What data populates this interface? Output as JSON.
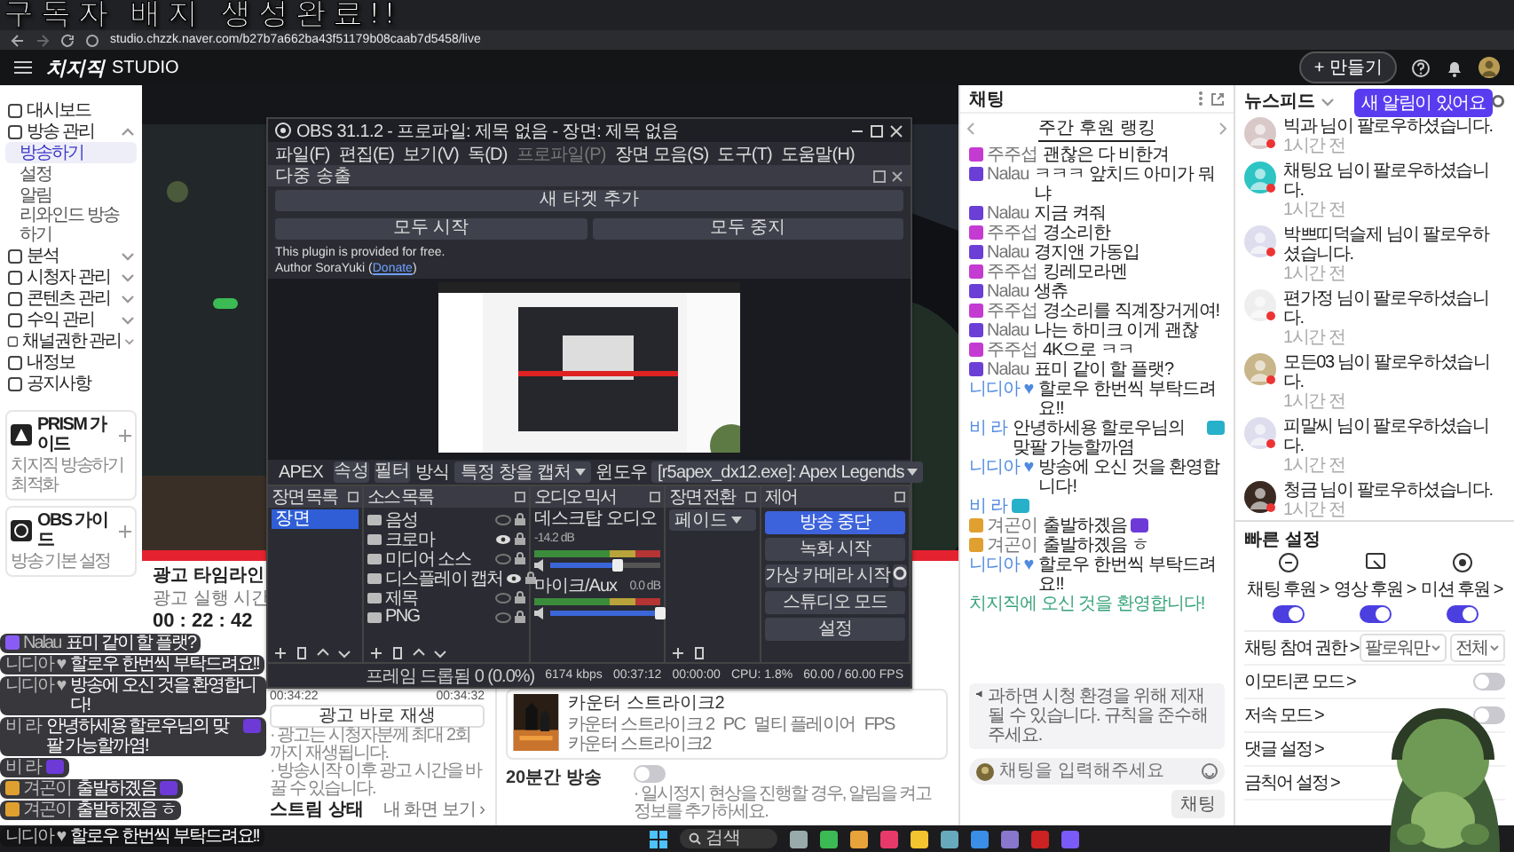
{
  "stream_overlay": {
    "title": "구독자 배지 생성완료!!"
  },
  "browser": {
    "url": "studio.chzzk.naver.com/b27b7a662ba43f51179b08caab7d5458/live"
  },
  "header": {
    "logo": "치지직",
    "product": "STUDIO",
    "create_button": "+ 만들기"
  },
  "sidebar": {
    "items": [
      {
        "label": "대시보드"
      },
      {
        "label": "방송 관리",
        "expanded": true,
        "children": [
          {
            "label": "방송하기",
            "selected": true
          },
          {
            "label": "설정",
            "selected": false
          },
          {
            "label": "알림",
            "selected": false
          },
          {
            "label": "리와인드 방송 하기",
            "selected": false
          }
        ]
      },
      {
        "label": "분석",
        "expanded": false
      },
      {
        "label": "시청자 관리",
        "expanded": false
      },
      {
        "label": "콘텐츠 관리",
        "expanded": false
      },
      {
        "label": "수익 관리",
        "expanded": false
      },
      {
        "label": "채널권한 관리",
        "expanded": false
      },
      {
        "label": "내정보"
      },
      {
        "label": "공지사항"
      }
    ],
    "guides": [
      {
        "title": "PRISM 가이드",
        "subtitle": "치지직 방송하기 최적화"
      },
      {
        "title": "OBS 가이드",
        "subtitle": "방송 기본 설정"
      }
    ]
  },
  "ad_timeline": {
    "title": "광고 타임라인",
    "label": "광고 실행 시간",
    "time": "00 : 22 : 42",
    "marks": [
      "00:34:22",
      "00:34:32"
    ],
    "button": "광고 바로 재생",
    "notes": [
      "· 광고는 시청자분께 최대 2회까지 재생됩니다.",
      "· 방송시작 이후 광고 시간을 바꿀 수 있습니다."
    ]
  },
  "stream_status": {
    "title": "스트림 상태",
    "link": "내 화면 보기 ›"
  },
  "game": {
    "title": "카운터 스트라이크2",
    "tags": [
      "카운터 스트라이크 2",
      "PC",
      "멀티 플레이어",
      "FPS",
      "카운터 스트라이크2"
    ]
  },
  "setting_row": {
    "label": "20분간 방송",
    "on": false,
    "note": "· 일시정지 현상을 진행할 경우, 알림을 켜고 정보를 추가하세요."
  },
  "obs": {
    "title": "OBS 31.1.2 - 프로파일: 제목 없음 - 장면: 제목 없음",
    "menu": [
      {
        "label": "파일(F)",
        "disabled": false
      },
      {
        "label": "편집(E)",
        "disabled": false
      },
      {
        "label": "보기(V)",
        "disabled": false
      },
      {
        "label": "독(D)",
        "disabled": false
      },
      {
        "label": "프로파일(P)",
        "disabled": true
      },
      {
        "label": "장면 모음(S)",
        "disabled": false
      },
      {
        "label": "도구(T)",
        "disabled": false
      },
      {
        "label": "도움말(H)",
        "disabled": false
      }
    ],
    "dock_title": "다중 송출",
    "add_button": "새 타겟 추가",
    "start_all": "모두 시작",
    "stop_all": "모두 중지",
    "plugin_text": "This plugin is provided for free.",
    "author_prefix": "Author SoraYuki (",
    "author_link": "Donate",
    "author_suffix": ")",
    "source_name": "APEX",
    "properties_button": "속성",
    "filters_button": "필터",
    "method_label": "방식",
    "method_value": "특정 창을 캡처",
    "window_label": "윈도우",
    "window_value": "[r5apex_dx12.exe]: Apex Legends",
    "scenes": {
      "title": "장면 목록",
      "items": [
        {
          "label": "장면",
          "selected": true
        }
      ]
    },
    "sources": {
      "title": "소스 목록",
      "items": [
        {
          "label": "음성",
          "visible": false
        },
        {
          "label": "크로마",
          "visible": true
        },
        {
          "label": "미디어 소스",
          "visible": false
        },
        {
          "label": "디스플레이 캡처",
          "visible": true
        },
        {
          "label": "제목",
          "visible": false
        },
        {
          "label": "PNG",
          "visible": false
        }
      ]
    },
    "mixer": {
      "title": "오디오 믹서",
      "channels": [
        {
          "name": "데스크탑 오디오",
          "reading": "-14.2 dB",
          "level": 0.62
        },
        {
          "name": "마이크/Aux",
          "reading": "0.0 dB",
          "level": 1
        }
      ]
    },
    "transitions": {
      "title": "장면 전환",
      "value": "페이드"
    },
    "controls": {
      "title": "제어",
      "buttons": [
        {
          "label": "방송 중단",
          "active": true
        },
        {
          "label": "녹화 시작",
          "active": false
        },
        {
          "label": "가상 카메라 시작",
          "active": false
        },
        {
          "label": "스튜디오 모드",
          "active": false
        },
        {
          "label": "설정",
          "active": false
        }
      ]
    },
    "status": [
      "프레임 드롭됨 0 (0.0%)",
      "6174 kbps",
      "00:37:12",
      "00:00:00",
      "CPU: 1.8%",
      "60.00 / 60.00 FPS"
    ]
  },
  "chat_overlay": [
    {
      "name": "Nalau",
      "color": "#8a5cf6",
      "text": "표미 같이 할 플랫?",
      "emote": false
    },
    {
      "name": "니디아 ♥",
      "text": "할로우 한번씩 부탁드려요!!",
      "emote": false
    },
    {
      "name": "니디아 ♥",
      "text": "방송에 오신 것을 환영합니다!",
      "emote": false
    },
    {
      "name": "비 라",
      "text": "안녕하세용 할로우님의 맞팔 가능할까염!",
      "emote": true
    },
    {
      "name": "비 라",
      "emote": true
    },
    {
      "name": "겨곤이",
      "color": "#e0a030",
      "text": "출발하곘음",
      "emote": true
    },
    {
      "name": "겨곤이",
      "color": "#e0a030",
      "text": "출발하곘음 ㅎ",
      "emote": false
    }
  ],
  "bottom_overlay": {
    "name": "니디아 ♥",
    "text": "할로우 한번씩 부탁드려요!!"
  },
  "chat": {
    "title": "채팅",
    "tab": "주간 후원 랭킹",
    "messages": [
      {
        "name": "주주섭",
        "color": "#c43bd1",
        "text": "괜찮은 다 비한겨",
        "emote": false
      },
      {
        "name": "Nalau",
        "color": "#6b3fd6",
        "text": "ㅋㅋㅋ 앞치드 아미가 뭐냐",
        "emote": false
      },
      {
        "name": "Nalau",
        "color": "#6b3fd6",
        "text": "지금 켜줘",
        "emote": false
      },
      {
        "name": "주주섭",
        "color": "#c43bd1",
        "text": "경소리한",
        "emote": false
      },
      {
        "name": "Nalau",
        "color": "#6b3fd6",
        "text": "경지앤 가동입",
        "emote": false
      },
      {
        "name": "주주섭",
        "color": "#c43bd1",
        "text": "킹레모라멘",
        "emote": false
      },
      {
        "name": "Nalau",
        "color": "#6b3fd6",
        "text": "생츄",
        "emote": false
      },
      {
        "name": "주주섭",
        "color": "#c43bd1",
        "text": "경소리를 직계장거게여!",
        "emote": false
      },
      {
        "name": "Nalau",
        "color": "#6b3fd6",
        "text": "나는 하미크 이게 괜찮",
        "emote": false
      },
      {
        "name": "주주섭",
        "color": "#c43bd1",
        "text": "4K으로 ㅋㅋ",
        "emote": false
      },
      {
        "name": "Nalau",
        "color": "#6b3fd6",
        "text": "표미 같이 할 플랫?",
        "emote": false
      },
      {
        "name": "니디아 ♥",
        "text": "할로우 한번씩 부탁드려요!!",
        "emote": false
      },
      {
        "name": "비 라",
        "text": "안녕하세용 할로우님의 맞팔 가능할까염",
        "emote": true
      },
      {
        "name": "니디아 ♥",
        "text": "방송에 오신 것을 환영합니다!",
        "emote": false
      },
      {
        "name": "비 라",
        "emote": true
      },
      {
        "name": "겨곤이",
        "color": "#e0a030",
        "text": "출발하곘음",
        "emote": true
      },
      {
        "name": "겨곤이",
        "color": "#e0a030",
        "text": "출발하곘음 ㅎ",
        "emote": false
      },
      {
        "name": "니디아 ♥",
        "text": "할로우 한번씩 부탁드려요!!",
        "emote": false
      }
    ],
    "system_message": "치지직에 오신 것을 환영합니다!",
    "notice": "과하면 시청 환경을 위해 제재될 수 있습니다. 규칙을 준수해 주세요.",
    "input_placeholder": "채팅을 입력해주세요",
    "send_button": "채팅"
  },
  "feed": {
    "title": "뉴스피드",
    "tooltip": "새 알림이 있어요",
    "items": [
      {
        "text": "빅과 님이 팔로우하셨습니다.",
        "time": "1시간 전"
      },
      {
        "text": "채팅요 님이 팔로우하셨습니다.",
        "time": "1시간 전"
      },
      {
        "text": "박쁘띠덕슬제 님이 팔로우하셨습니다.",
        "time": "1시간 전"
      },
      {
        "text": "편가정 님이 팔로우하셨습니다.",
        "time": "1시간 전"
      },
      {
        "text": "모든03 님이 팔로우하셨습니다.",
        "time": "1시간 전"
      },
      {
        "text": "피말씨 님이 팔로우하셨습니다.",
        "time": "1시간 전"
      },
      {
        "text": "청금 님이 팔로우하셨습니다.",
        "time": "1시간 전"
      }
    ]
  },
  "quick_settings": {
    "title": "빠른 설정",
    "toggles": [
      {
        "label": "채팅 후원 >",
        "on": true
      },
      {
        "label": "영상 후원 >",
        "on": true
      },
      {
        "label": "미션 후원 >",
        "on": true
      }
    ],
    "rows": [
      {
        "kind": "dropdowns",
        "label": "채팅 참여 권한 >",
        "options": [
          "팔로워만",
          "전체"
        ]
      },
      {
        "kind": "toggle",
        "label": "이모티콘 모드 >",
        "on": false
      },
      {
        "kind": "toggle",
        "label": "저속 모드 >",
        "on": false
      },
      {
        "kind": "link",
        "label": "댓글 설정 >"
      },
      {
        "kind": "link",
        "label": "금칙어 설정 >"
      }
    ]
  },
  "taskbar": {
    "search_placeholder": "검색"
  }
}
